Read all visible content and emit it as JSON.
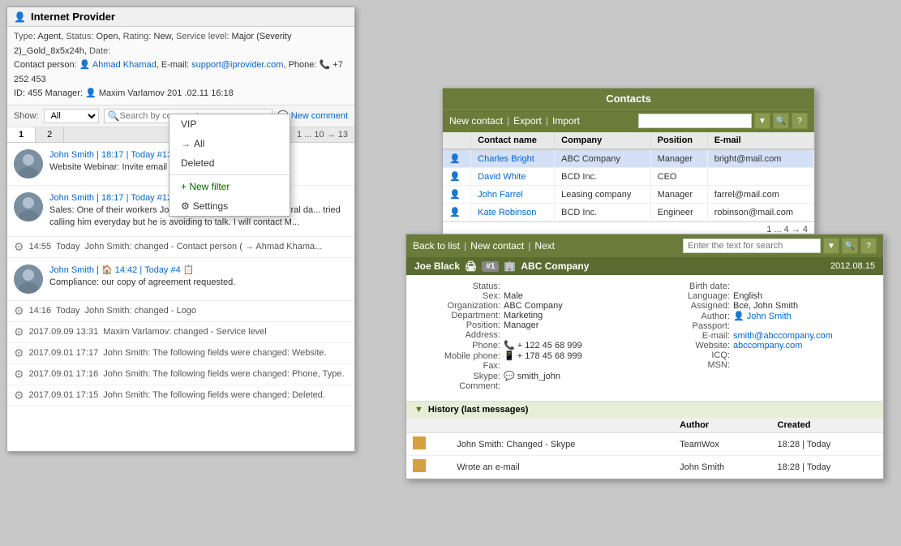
{
  "ticket": {
    "title": "Internet Provider",
    "meta": {
      "type": "Agent",
      "status": "Open",
      "rating": "New",
      "service_level": "Major (Severity 2)_Gold_8x5x24h",
      "contact_person_label": "Contact person:",
      "contact_person": "Ahmad Khamad",
      "email_label": "E-mail:",
      "email": "support@iprovider.com",
      "phone_label": "Phone:",
      "phone": "+7 252 453",
      "id_label": "ID:",
      "id": "455",
      "manager_label": "Manager:",
      "manager": "Maxim Varlamov",
      "date": "201 .02.11 16:18"
    },
    "toolbar": {
      "show_label": "Show:",
      "show_value": "All",
      "search_placeholder": "Search by comment",
      "new_comment": "New comment"
    },
    "tabs": [
      "1",
      "2"
    ],
    "pagination": "1 ... 10 → 13",
    "comments": [
      {
        "id": "c1",
        "author": "John Smith",
        "time": "18:17",
        "day": "Today",
        "hash": "#13",
        "text": "Website Webinar: Invite email sent."
      },
      {
        "id": "c2",
        "author": "John Smith",
        "time": "18:17",
        "day": "Today",
        "hash": "#12",
        "text": "Sales: One of their workers Joe Smith contacted our TS several da... tried calling him everyday but he is avoiding to talk. I will contact M..."
      }
    ],
    "system_events": [
      {
        "time": "14:55",
        "day": "Today",
        "text": "John Smith: changed - Contact person ( → Ahmad Khama..."
      },
      {
        "time": "14:16",
        "day": "Today",
        "text": "John Smith: changed - Logo"
      },
      {
        "time": "2017.09.09 13:31",
        "day": "",
        "text": "Maxim Varlamov: changed - Service level"
      },
      {
        "time": "2017.09.01 17:17",
        "day": "",
        "text": "John Smith: The following fields were changed: Website."
      },
      {
        "time": "2017.09.01 17:16",
        "day": "",
        "text": "John Smith: The following fields were changed: Phone, Type."
      },
      {
        "time": "2017.09.01 17:15",
        "day": "",
        "text": "John Smith: The following fields were changed: Deleted."
      }
    ],
    "comment_c3": {
      "author": "John Smith",
      "time": "14:42",
      "day": "Today",
      "hash": "#4",
      "text": "Compliance: our copy of agreement requested."
    }
  },
  "dropdown": {
    "items": [
      "VIP",
      "All",
      "Deleted"
    ],
    "active": "All",
    "new_filter": "+ New filter",
    "settings": "Settings"
  },
  "contacts": {
    "title": "Contacts",
    "toolbar": {
      "new_contact": "New contact",
      "export": "Export",
      "import": "Import",
      "search_placeholder": ""
    },
    "columns": [
      "",
      "Contact name",
      "Company",
      "Position",
      "E-mail"
    ],
    "rows": [
      {
        "name": "Charles Bright",
        "company": "ABC Company",
        "position": "Manager",
        "email": "bright@mail.com"
      },
      {
        "name": "David White",
        "company": "BCD Inc.",
        "position": "CEO",
        "email": ""
      },
      {
        "name": "John Farrel",
        "company": "Leasing company",
        "position": "Manager",
        "email": "farrel@mail.com"
      },
      {
        "name": "Kate Robinson",
        "company": "BCD Inc.",
        "position": "Engineer",
        "email": "robinson@mail.com"
      }
    ],
    "pagination": "1 ... 4 → 4"
  },
  "contact_detail": {
    "toolbar": {
      "back": "Back to list",
      "new_contact": "New contact",
      "next": "Next",
      "search_placeholder": "Enter the text for search"
    },
    "header": {
      "name": "Joe Black",
      "badge": "#1",
      "company": "ABC Company",
      "date": "2012.08.15"
    },
    "fields_left": {
      "status_label": "Status:",
      "status_value": "",
      "sex_label": "Sex:",
      "sex_value": "Male",
      "org_label": "Organization:",
      "org_value": "ABC Company",
      "dept_label": "Department:",
      "dept_value": "Marketing",
      "pos_label": "Position:",
      "pos_value": "Manager",
      "addr_label": "Address:",
      "addr_value": "",
      "phone_label": "Phone:",
      "phone_value": "+ 122 45 68 999",
      "mobile_label": "Mobile phone:",
      "mobile_value": "+ 178 45 68 999",
      "fax_label": "Fax:",
      "fax_value": "",
      "skype_label": "Skype:",
      "skype_value": "smith_john",
      "comment_label": "Comment:",
      "comment_value": ""
    },
    "fields_right": {
      "birthdate_label": "Birth date:",
      "birthdate_value": "",
      "language_label": "Language:",
      "language_value": "English",
      "assigned_label": "Assigned:",
      "assigned_value": "Все, John Smith",
      "author_label": "Author:",
      "author_value": "John Smith",
      "passport_label": "Passport:",
      "passport_value": "",
      "email_label": "E-mail:",
      "email_value": "smith@abccompany.com",
      "website_label": "Website:",
      "website_value": "abccompany.com",
      "icq_label": "ICQ:",
      "icq_value": "",
      "msn_label": "MSN:",
      "msn_value": ""
    },
    "history": {
      "title": "History (last messages)",
      "columns": [
        "",
        "",
        "Author",
        "Created"
      ],
      "rows": [
        {
          "text": "John Smith: Changed - Skype",
          "author": "TeamWox",
          "created": "18:28 | Today"
        },
        {
          "text": "Wrote an e-mail",
          "author": "John Smith",
          "created": "18:28 | Today"
        }
      ]
    }
  }
}
